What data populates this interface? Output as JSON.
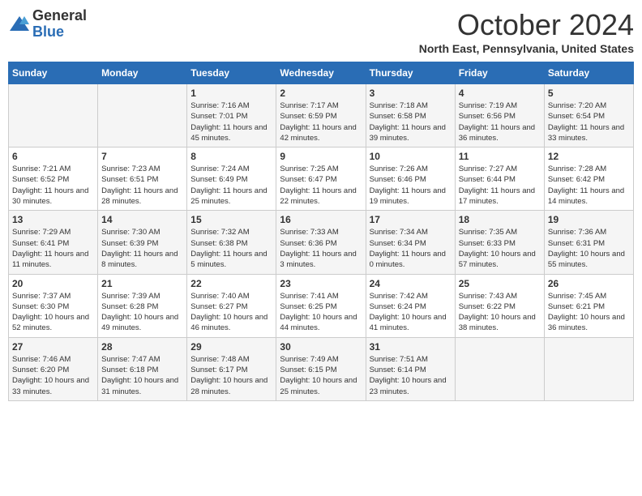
{
  "header": {
    "logo_general": "General",
    "logo_blue": "Blue",
    "month_title": "October 2024",
    "location": "North East, Pennsylvania, United States"
  },
  "days_of_week": [
    "Sunday",
    "Monday",
    "Tuesday",
    "Wednesday",
    "Thursday",
    "Friday",
    "Saturday"
  ],
  "weeks": [
    [
      {
        "day": "",
        "info": ""
      },
      {
        "day": "",
        "info": ""
      },
      {
        "day": "1",
        "info": "Sunrise: 7:16 AM\nSunset: 7:01 PM\nDaylight: 11 hours and 45 minutes."
      },
      {
        "day": "2",
        "info": "Sunrise: 7:17 AM\nSunset: 6:59 PM\nDaylight: 11 hours and 42 minutes."
      },
      {
        "day": "3",
        "info": "Sunrise: 7:18 AM\nSunset: 6:58 PM\nDaylight: 11 hours and 39 minutes."
      },
      {
        "day": "4",
        "info": "Sunrise: 7:19 AM\nSunset: 6:56 PM\nDaylight: 11 hours and 36 minutes."
      },
      {
        "day": "5",
        "info": "Sunrise: 7:20 AM\nSunset: 6:54 PM\nDaylight: 11 hours and 33 minutes."
      }
    ],
    [
      {
        "day": "6",
        "info": "Sunrise: 7:21 AM\nSunset: 6:52 PM\nDaylight: 11 hours and 30 minutes."
      },
      {
        "day": "7",
        "info": "Sunrise: 7:23 AM\nSunset: 6:51 PM\nDaylight: 11 hours and 28 minutes."
      },
      {
        "day": "8",
        "info": "Sunrise: 7:24 AM\nSunset: 6:49 PM\nDaylight: 11 hours and 25 minutes."
      },
      {
        "day": "9",
        "info": "Sunrise: 7:25 AM\nSunset: 6:47 PM\nDaylight: 11 hours and 22 minutes."
      },
      {
        "day": "10",
        "info": "Sunrise: 7:26 AM\nSunset: 6:46 PM\nDaylight: 11 hours and 19 minutes."
      },
      {
        "day": "11",
        "info": "Sunrise: 7:27 AM\nSunset: 6:44 PM\nDaylight: 11 hours and 17 minutes."
      },
      {
        "day": "12",
        "info": "Sunrise: 7:28 AM\nSunset: 6:42 PM\nDaylight: 11 hours and 14 minutes."
      }
    ],
    [
      {
        "day": "13",
        "info": "Sunrise: 7:29 AM\nSunset: 6:41 PM\nDaylight: 11 hours and 11 minutes."
      },
      {
        "day": "14",
        "info": "Sunrise: 7:30 AM\nSunset: 6:39 PM\nDaylight: 11 hours and 8 minutes."
      },
      {
        "day": "15",
        "info": "Sunrise: 7:32 AM\nSunset: 6:38 PM\nDaylight: 11 hours and 5 minutes."
      },
      {
        "day": "16",
        "info": "Sunrise: 7:33 AM\nSunset: 6:36 PM\nDaylight: 11 hours and 3 minutes."
      },
      {
        "day": "17",
        "info": "Sunrise: 7:34 AM\nSunset: 6:34 PM\nDaylight: 11 hours and 0 minutes."
      },
      {
        "day": "18",
        "info": "Sunrise: 7:35 AM\nSunset: 6:33 PM\nDaylight: 10 hours and 57 minutes."
      },
      {
        "day": "19",
        "info": "Sunrise: 7:36 AM\nSunset: 6:31 PM\nDaylight: 10 hours and 55 minutes."
      }
    ],
    [
      {
        "day": "20",
        "info": "Sunrise: 7:37 AM\nSunset: 6:30 PM\nDaylight: 10 hours and 52 minutes."
      },
      {
        "day": "21",
        "info": "Sunrise: 7:39 AM\nSunset: 6:28 PM\nDaylight: 10 hours and 49 minutes."
      },
      {
        "day": "22",
        "info": "Sunrise: 7:40 AM\nSunset: 6:27 PM\nDaylight: 10 hours and 46 minutes."
      },
      {
        "day": "23",
        "info": "Sunrise: 7:41 AM\nSunset: 6:25 PM\nDaylight: 10 hours and 44 minutes."
      },
      {
        "day": "24",
        "info": "Sunrise: 7:42 AM\nSunset: 6:24 PM\nDaylight: 10 hours and 41 minutes."
      },
      {
        "day": "25",
        "info": "Sunrise: 7:43 AM\nSunset: 6:22 PM\nDaylight: 10 hours and 38 minutes."
      },
      {
        "day": "26",
        "info": "Sunrise: 7:45 AM\nSunset: 6:21 PM\nDaylight: 10 hours and 36 minutes."
      }
    ],
    [
      {
        "day": "27",
        "info": "Sunrise: 7:46 AM\nSunset: 6:20 PM\nDaylight: 10 hours and 33 minutes."
      },
      {
        "day": "28",
        "info": "Sunrise: 7:47 AM\nSunset: 6:18 PM\nDaylight: 10 hours and 31 minutes."
      },
      {
        "day": "29",
        "info": "Sunrise: 7:48 AM\nSunset: 6:17 PM\nDaylight: 10 hours and 28 minutes."
      },
      {
        "day": "30",
        "info": "Sunrise: 7:49 AM\nSunset: 6:15 PM\nDaylight: 10 hours and 25 minutes."
      },
      {
        "day": "31",
        "info": "Sunrise: 7:51 AM\nSunset: 6:14 PM\nDaylight: 10 hours and 23 minutes."
      },
      {
        "day": "",
        "info": ""
      },
      {
        "day": "",
        "info": ""
      }
    ]
  ]
}
